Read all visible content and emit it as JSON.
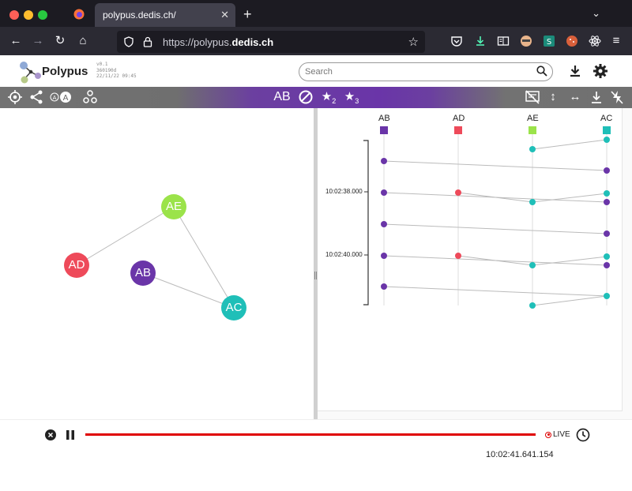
{
  "browser": {
    "tab_title": "polypus.dedis.ch/",
    "tab_close": "✕",
    "new_tab": "+",
    "tab_list": "⌄",
    "url_prefix": "https://polypus.",
    "url_domain": "dedis.ch",
    "nav": {
      "back": "←",
      "forward": "→",
      "reload": "↻",
      "home": "⌂"
    }
  },
  "app": {
    "name": "Polypus",
    "version_lines": [
      "v0.1",
      "360190d",
      "22/11/22 09:45"
    ],
    "search_placeholder": "Search"
  },
  "toolbar": {
    "center_label": "AB",
    "star2_sub": "2",
    "star3_sub": "3"
  },
  "graph": {
    "nodes": [
      {
        "id": "AE",
        "label": "AE",
        "color": "#9be34a"
      },
      {
        "id": "AD",
        "label": "AD",
        "color": "#ee4a5a"
      },
      {
        "id": "AB",
        "label": "AB",
        "color": "#6a35a8"
      },
      {
        "id": "AC",
        "label": "AC",
        "color": "#1fbfb8"
      }
    ],
    "edges": [
      [
        "AD",
        "AE"
      ],
      [
        "AE",
        "AC"
      ],
      [
        "AB",
        "AC"
      ]
    ]
  },
  "sequence": {
    "columns": [
      {
        "id": "AB",
        "label": "AB",
        "color": "#6a35a8"
      },
      {
        "id": "AD",
        "label": "AD",
        "color": "#ee4a5a"
      },
      {
        "id": "AE",
        "label": "AE",
        "color": "#9be34a"
      },
      {
        "id": "AC",
        "label": "AC",
        "color": "#1fbfb8"
      }
    ],
    "time_labels": [
      "10:02:38.000",
      "10:02:40.000"
    ]
  },
  "player": {
    "live_label": "LIVE",
    "current_time": "10:02:41.641.154"
  }
}
